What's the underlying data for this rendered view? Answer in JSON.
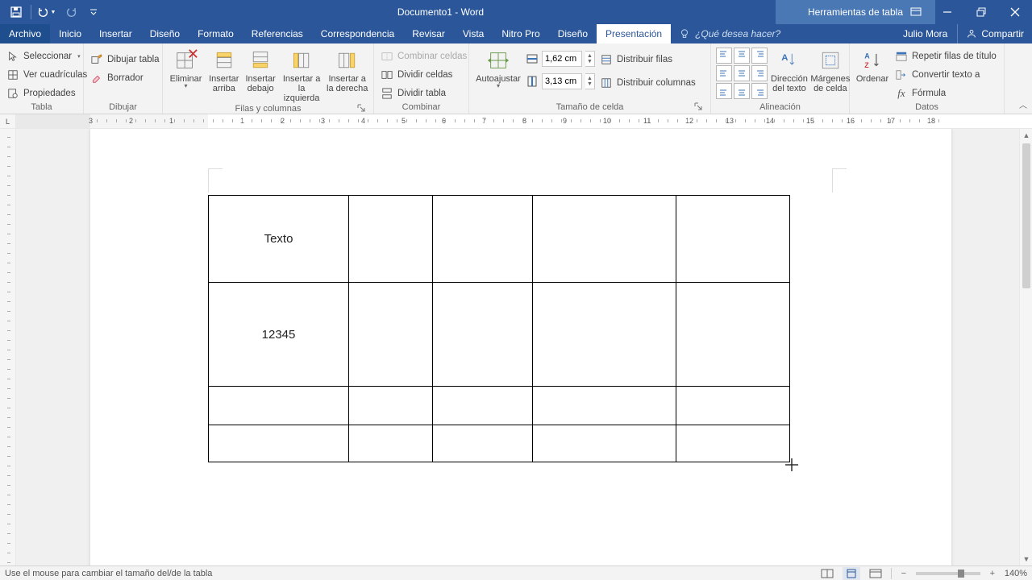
{
  "titlebar": {
    "doc_title": "Documento1 - Word",
    "context_title": "Herramientas de tabla"
  },
  "tabs": {
    "file": "Archivo",
    "inicio": "Inicio",
    "insertar": "Insertar",
    "diseno": "Diseño",
    "formato": "Formato",
    "referencias": "Referencias",
    "correspondencia": "Correspondencia",
    "revisar": "Revisar",
    "vista": "Vista",
    "nitro": "Nitro Pro",
    "table_diseno": "Diseño",
    "presentacion": "Presentación",
    "tellme_placeholder": "¿Qué desea hacer?",
    "user": "Julio Mora",
    "share": "Compartir"
  },
  "ribbon": {
    "tabla": {
      "label": "Tabla",
      "seleccionar": "Seleccionar",
      "ver_cuadriculas": "Ver cuadrículas",
      "propiedades": "Propiedades"
    },
    "dibujar": {
      "label": "Dibujar",
      "dibujar_tabla": "Dibujar tabla",
      "borrador": "Borrador"
    },
    "filas_columnas": {
      "label": "Filas y columnas",
      "eliminar": "Eliminar",
      "ins_arriba": "Insertar arriba",
      "ins_debajo": "Insertar debajo",
      "ins_izq": "Insertar a la izquierda",
      "ins_der": "Insertar a la derecha"
    },
    "combinar": {
      "label": "Combinar",
      "combinar_celdas": "Combinar celdas",
      "dividir_celdas": "Dividir celdas",
      "dividir_tabla": "Dividir tabla"
    },
    "tamano": {
      "label": "Tamaño de celda",
      "autoajustar": "Autoajustar",
      "alto": "1,62 cm",
      "ancho": "3,13 cm",
      "dist_filas": "Distribuir filas",
      "dist_cols": "Distribuir columnas"
    },
    "alineacion": {
      "label": "Alineación",
      "direccion": "Dirección del texto",
      "margenes": "Márgenes de celda"
    },
    "datos": {
      "label": "Datos",
      "ordenar": "Ordenar",
      "repetir": "Repetir filas de título",
      "convertir": "Convertir texto a",
      "formula": "Fórmula"
    }
  },
  "ruler_numbers": [
    "3",
    "2",
    "1",
    "1",
    "2",
    "3",
    "4",
    "5",
    "6",
    "7",
    "8",
    "9",
    "10",
    "11",
    "12",
    "13",
    "14",
    "15",
    "16",
    "17",
    "18"
  ],
  "table_content": {
    "r1c1": "Texto",
    "r2c1": "12345"
  },
  "statusbar": {
    "msg": "Use el mouse para cambiar el tamaño del/de la tabla",
    "zoom": "140%"
  }
}
